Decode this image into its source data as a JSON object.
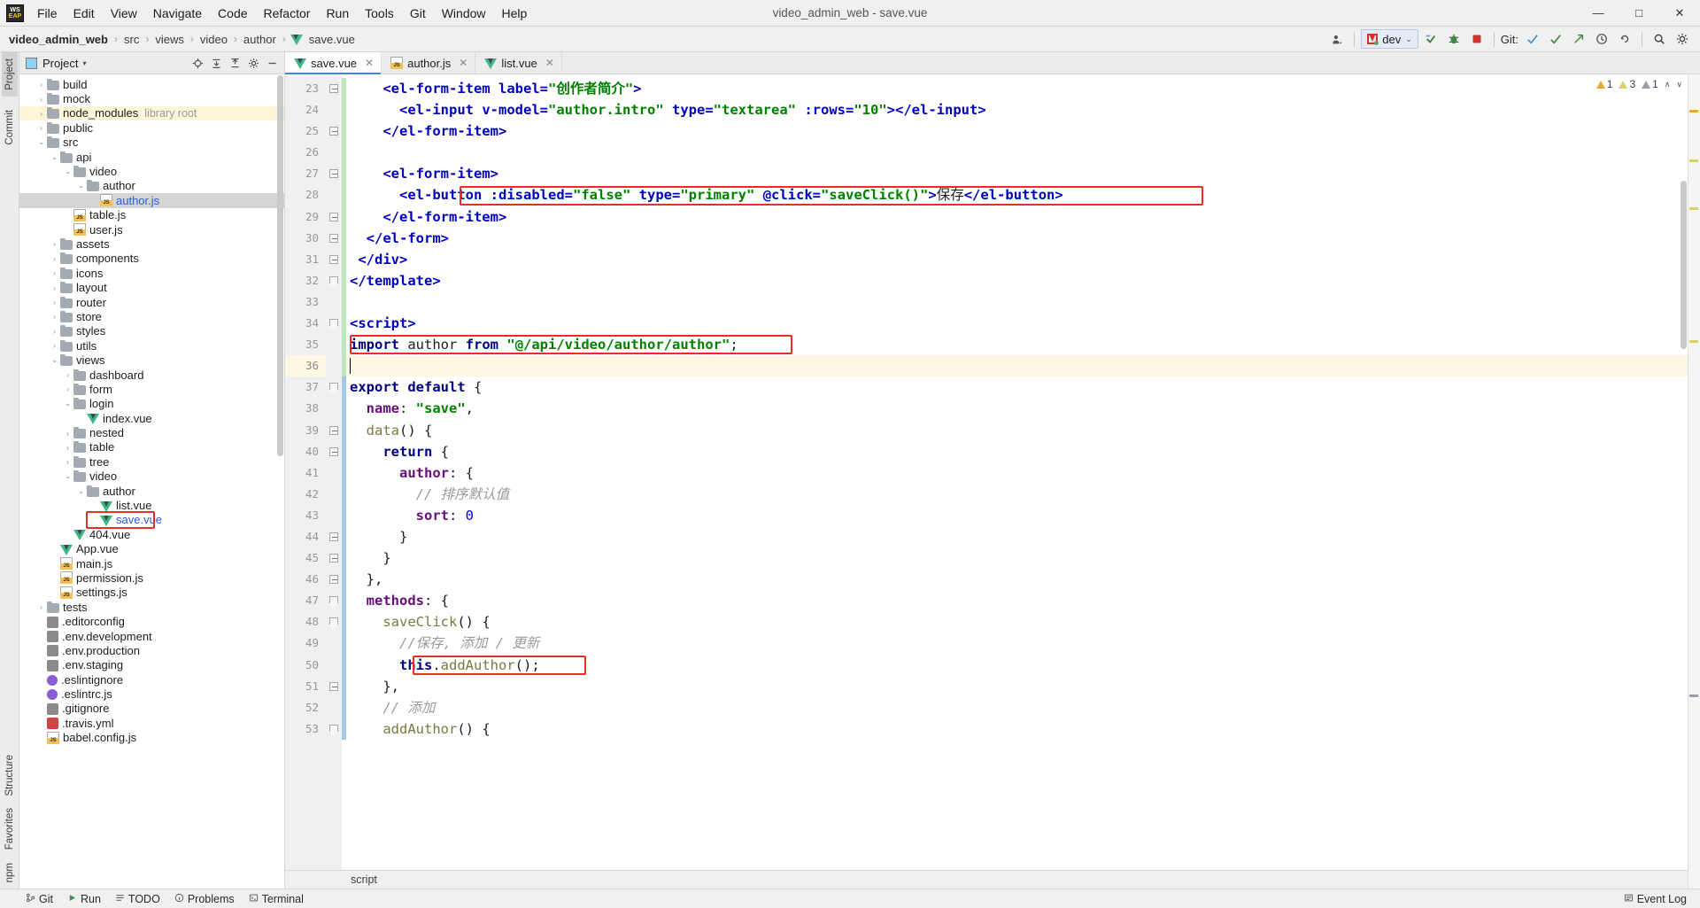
{
  "window": {
    "app_icon_top": "WS",
    "app_icon_bottom": "EAP",
    "title": "video_admin_web - save.vue",
    "minimize": "—",
    "maximize": "□",
    "close": "✕"
  },
  "menu": [
    {
      "label": "File"
    },
    {
      "label": "Edit"
    },
    {
      "label": "View"
    },
    {
      "label": "Navigate"
    },
    {
      "label": "Code"
    },
    {
      "label": "Refactor"
    },
    {
      "label": "Run"
    },
    {
      "label": "Tools"
    },
    {
      "label": "Git"
    },
    {
      "label": "Window"
    },
    {
      "label": "Help"
    }
  ],
  "breadcrumb": {
    "items": [
      "video_admin_web",
      "src",
      "views",
      "video",
      "author",
      "save.vue"
    ],
    "separator": "›"
  },
  "toolbar_right": {
    "user_icon": "user-icon",
    "run_config": "dev",
    "caret": "⌄",
    "build_icon": "↻",
    "bug_icon": "🐞",
    "stop_icon": "■",
    "git_label": "Git:",
    "update_icon": "✓",
    "commit_icon": "✓",
    "push_icon": "↗",
    "history_icon": "↺",
    "rollback_icon": "↶",
    "search_icon": "🔍",
    "settings_icon": "⚙"
  },
  "rails": {
    "left_top": [
      "Project"
    ],
    "left_mid": [
      "Commit"
    ],
    "left_bottom": [
      "Structure",
      "Favorites"
    ],
    "far_bottom": [
      "npm"
    ]
  },
  "project_panel": {
    "title": "Project",
    "caret": "▾",
    "tools": [
      "⊕",
      "↧",
      "↥",
      "⚙",
      "—"
    ],
    "tree": [
      {
        "depth": 1,
        "arrow": "›",
        "icon": "folder",
        "label": "build"
      },
      {
        "depth": 1,
        "arrow": "›",
        "icon": "folder",
        "label": "mock"
      },
      {
        "depth": 1,
        "arrow": "›",
        "icon": "folder",
        "label": "node_modules",
        "sub": "library root",
        "highlight": true
      },
      {
        "depth": 1,
        "arrow": "›",
        "icon": "folder",
        "label": "public"
      },
      {
        "depth": 1,
        "arrow": "⌄",
        "icon": "folder",
        "label": "src"
      },
      {
        "depth": 2,
        "arrow": "⌄",
        "icon": "folder",
        "label": "api"
      },
      {
        "depth": 3,
        "arrow": "⌄",
        "icon": "folder",
        "label": "video"
      },
      {
        "depth": 4,
        "arrow": "⌄",
        "icon": "folder",
        "label": "author"
      },
      {
        "depth": 5,
        "arrow": "",
        "icon": "js",
        "label": "author.js",
        "selected": true,
        "blue": true
      },
      {
        "depth": 3,
        "arrow": "",
        "icon": "js",
        "label": "table.js"
      },
      {
        "depth": 3,
        "arrow": "",
        "icon": "js",
        "label": "user.js"
      },
      {
        "depth": 2,
        "arrow": "›",
        "icon": "folder",
        "label": "assets"
      },
      {
        "depth": 2,
        "arrow": "›",
        "icon": "folder",
        "label": "components"
      },
      {
        "depth": 2,
        "arrow": "›",
        "icon": "folder",
        "label": "icons"
      },
      {
        "depth": 2,
        "arrow": "›",
        "icon": "folder",
        "label": "layout"
      },
      {
        "depth": 2,
        "arrow": "›",
        "icon": "folder",
        "label": "router"
      },
      {
        "depth": 2,
        "arrow": "›",
        "icon": "folder",
        "label": "store"
      },
      {
        "depth": 2,
        "arrow": "›",
        "icon": "folder",
        "label": "styles"
      },
      {
        "depth": 2,
        "arrow": "›",
        "icon": "folder",
        "label": "utils"
      },
      {
        "depth": 2,
        "arrow": "⌄",
        "icon": "folder",
        "label": "views"
      },
      {
        "depth": 3,
        "arrow": "›",
        "icon": "folder",
        "label": "dashboard"
      },
      {
        "depth": 3,
        "arrow": "›",
        "icon": "folder",
        "label": "form"
      },
      {
        "depth": 3,
        "arrow": "⌄",
        "icon": "folder",
        "label": "login"
      },
      {
        "depth": 4,
        "arrow": "",
        "icon": "vue",
        "label": "index.vue"
      },
      {
        "depth": 3,
        "arrow": "›",
        "icon": "folder",
        "label": "nested"
      },
      {
        "depth": 3,
        "arrow": "›",
        "icon": "folder",
        "label": "table"
      },
      {
        "depth": 3,
        "arrow": "›",
        "icon": "folder",
        "label": "tree"
      },
      {
        "depth": 3,
        "arrow": "⌄",
        "icon": "folder",
        "label": "video"
      },
      {
        "depth": 4,
        "arrow": "⌄",
        "icon": "folder",
        "label": "author"
      },
      {
        "depth": 5,
        "arrow": "",
        "icon": "vue",
        "label": "list.vue"
      },
      {
        "depth": 5,
        "arrow": "",
        "icon": "vue",
        "label": "save.vue",
        "blue": true,
        "boxed": true
      },
      {
        "depth": 3,
        "arrow": "",
        "icon": "vue",
        "label": "404.vue"
      },
      {
        "depth": 2,
        "arrow": "",
        "icon": "vue",
        "label": "App.vue"
      },
      {
        "depth": 2,
        "arrow": "",
        "icon": "js",
        "label": "main.js"
      },
      {
        "depth": 2,
        "arrow": "",
        "icon": "js",
        "label": "permission.js"
      },
      {
        "depth": 2,
        "arrow": "",
        "icon": "js",
        "label": "settings.js"
      },
      {
        "depth": 1,
        "arrow": "›",
        "icon": "folder",
        "label": "tests"
      },
      {
        "depth": 1,
        "arrow": "",
        "icon": "cfg",
        "label": ".editorconfig"
      },
      {
        "depth": 1,
        "arrow": "",
        "icon": "cfg",
        "label": ".env.development"
      },
      {
        "depth": 1,
        "arrow": "",
        "icon": "cfg",
        "label": ".env.production"
      },
      {
        "depth": 1,
        "arrow": "",
        "icon": "cfg",
        "label": ".env.staging"
      },
      {
        "depth": 1,
        "arrow": "",
        "icon": "circ",
        "label": ".eslintignore"
      },
      {
        "depth": 1,
        "arrow": "",
        "icon": "circ",
        "label": ".eslintrc.js"
      },
      {
        "depth": 1,
        "arrow": "",
        "icon": "cfg",
        "label": ".gitignore"
      },
      {
        "depth": 1,
        "arrow": "",
        "icon": "yml",
        "label": ".travis.yml"
      },
      {
        "depth": 1,
        "arrow": "",
        "icon": "js",
        "label": "babel.config.js"
      }
    ]
  },
  "tabs": [
    {
      "label": "save.vue",
      "icon": "vue",
      "active": true,
      "close": "✕"
    },
    {
      "label": "author.js",
      "icon": "js",
      "active": false,
      "close": "✕"
    },
    {
      "label": "list.vue",
      "icon": "vue",
      "active": false,
      "close": "✕"
    }
  ],
  "inspections": {
    "warnings": "1",
    "weak_warnings": "3",
    "typos": "1",
    "caret_up": "∧",
    "caret_down": "∨"
  },
  "editor": {
    "first_line": 23,
    "current_line": 36,
    "lines": [
      {
        "n": 23,
        "indent": "",
        "html": "<span class='t-plain'>    </span><span class='t-tag'>&lt;el-form-item</span> <span class='t-attr'>label=</span><span class='t-str'>\"创作者简介\"</span><span class='t-tag'>&gt;</span>"
      },
      {
        "n": 24,
        "indent": "",
        "html": "<span class='t-plain'>      </span><span class='t-tag'>&lt;el-input</span> <span class='t-attr'>v-model=</span><span class='t-str'>\"author.intro\"</span> <span class='t-attr'>type=</span><span class='t-str'>\"textarea\"</span> <span class='t-attr'>:rows=</span><span class='t-str'>\"10\"</span><span class='t-tag'>&gt;&lt;/el-input&gt;</span>"
      },
      {
        "n": 25,
        "indent": "",
        "html": "<span class='t-plain'>    </span><span class='t-tag'>&lt;/el-form-item&gt;</span>"
      },
      {
        "n": 26,
        "indent": "",
        "html": ""
      },
      {
        "n": 27,
        "indent": "",
        "html": "<span class='t-plain'>    </span><span class='t-tag'>&lt;el-form-item&gt;</span>"
      },
      {
        "n": 28,
        "indent": "",
        "html": "<span class='t-plain'>      </span><span class='t-tag'>&lt;el-button</span> <span class='t-attr'>:disabled=</span><span class='t-str'>\"false\"</span> <span class='t-attr'>type=</span><span class='t-str'>\"primary\"</span> <span class='t-attr'>@click=</span><span class='t-str'>\"saveClick()\"</span><span class='t-tag'>&gt;</span><span class='t-plain'>保存</span><span class='t-tag'>&lt;/el-button&gt;</span>"
      },
      {
        "n": 29,
        "indent": "",
        "html": "<span class='t-plain'>    </span><span class='t-tag'>&lt;/el-form-item&gt;</span>"
      },
      {
        "n": 30,
        "indent": "",
        "html": "<span class='t-plain'>  </span><span class='t-tag'>&lt;/el-form&gt;</span>"
      },
      {
        "n": 31,
        "indent": "",
        "html": "<span class='t-plain'> </span><span class='t-tag'>&lt;/div&gt;</span>"
      },
      {
        "n": 32,
        "indent": "",
        "html": "<span class='t-tag'>&lt;/template&gt;</span>"
      },
      {
        "n": 33,
        "indent": "",
        "html": ""
      },
      {
        "n": 34,
        "indent": "",
        "html": "<span class='t-tag'>&lt;script&gt;</span>"
      },
      {
        "n": 35,
        "indent": "",
        "html": "<span class='t-kw'>import</span> <span class='t-id'>author</span> <span class='t-kw'>from</span> <span class='t-str'>\"@/api/video/author/author\"</span><span class='t-plain'>;</span>"
      },
      {
        "n": 36,
        "indent": "",
        "html": "<span class='caret'></span>",
        "current": true
      },
      {
        "n": 37,
        "indent": "",
        "html": "<span class='t-kw'>export default</span> <span class='t-plain'>{</span>"
      },
      {
        "n": 38,
        "indent": "",
        "html": "<span class='t-plain'>  </span><span class='t-prop'>name</span><span class='t-plain'>: </span><span class='t-str'>\"save\"</span><span class='t-plain'>,</span>"
      },
      {
        "n": 39,
        "indent": "",
        "html": "<span class='t-plain'>  </span><span class='t-fn'>data</span><span class='t-plain'>() {</span>"
      },
      {
        "n": 40,
        "indent": "",
        "html": "<span class='t-plain'>    </span><span class='t-kw'>return</span> <span class='t-plain'>{</span>"
      },
      {
        "n": 41,
        "indent": "",
        "html": "<span class='t-plain'>      </span><span class='t-prop'>author</span><span class='t-plain'>: {</span>"
      },
      {
        "n": 42,
        "indent": "",
        "html": "<span class='t-plain'>        </span><span class='t-cmt'>// 排序默认值</span>"
      },
      {
        "n": 43,
        "indent": "",
        "html": "<span class='t-plain'>        </span><span class='t-prop'>sort</span><span class='t-plain'>: </span><span class='t-num'>0</span>"
      },
      {
        "n": 44,
        "indent": "",
        "html": "<span class='t-plain'>      }</span>"
      },
      {
        "n": 45,
        "indent": "",
        "html": "<span class='t-plain'>    }</span>"
      },
      {
        "n": 46,
        "indent": "",
        "html": "<span class='t-plain'>  },</span>"
      },
      {
        "n": 47,
        "indent": "",
        "html": "<span class='t-plain'>  </span><span class='t-prop'>methods</span><span class='t-plain'>: {</span>"
      },
      {
        "n": 48,
        "indent": "",
        "html": "<span class='t-plain'>    </span><span class='t-fn'>saveClick</span><span class='t-plain'>() {</span>"
      },
      {
        "n": 49,
        "indent": "",
        "html": "<span class='t-plain'>      </span><span class='t-cmt'>//保存, 添加 / 更新</span>"
      },
      {
        "n": 50,
        "indent": "",
        "html": "<span class='t-plain'>      </span><span class='t-kw'>this</span><span class='t-plain'>.</span><span class='t-fn'>addAuthor</span><span class='t-plain'>();</span>"
      },
      {
        "n": 51,
        "indent": "",
        "html": "<span class='t-plain'>    },</span>"
      },
      {
        "n": 52,
        "indent": "",
        "html": "<span class='t-plain'>    </span><span class='t-cmt'>// 添加</span>"
      },
      {
        "n": 53,
        "indent": "",
        "html": "<span class='t-plain'>    </span><span class='t-fn'>addAuthor</span><span class='t-plain'>() {</span>"
      }
    ],
    "footer_breadcrumb": "script"
  },
  "statusbar": {
    "left": [
      {
        "icon": "⎇",
        "label": "Git"
      },
      {
        "icon": "▶",
        "label": "Run"
      },
      {
        "icon": "≡",
        "label": "TODO"
      },
      {
        "icon": "ⓘ",
        "label": "Problems"
      },
      {
        "icon": "▣",
        "label": "Terminal"
      }
    ],
    "right": [
      {
        "icon": "☰",
        "label": "Event Log"
      }
    ]
  },
  "colors": {
    "accent": "#2b5ed6",
    "highlight_box": "#e3312a",
    "vue_green": "#41b883",
    "tab_underline": "#4a86c8",
    "current_line": "#fdf8e3"
  }
}
